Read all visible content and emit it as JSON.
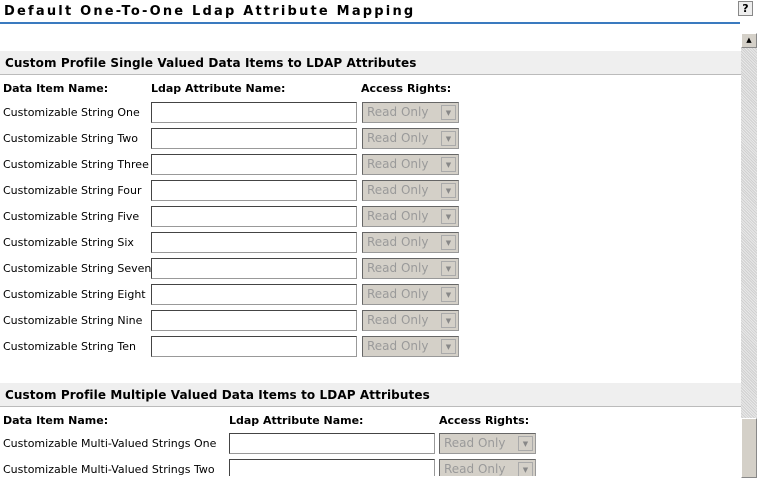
{
  "title": "Default One-To-One Ldap Attribute Mapping",
  "help_label": "?",
  "single": {
    "heading": "Custom Profile Single Valued Data Items to LDAP Attributes",
    "col_item": "Data Item Name:",
    "col_attr": "Ldap Attribute Name:",
    "col_rights": "Access Rights:",
    "rows": [
      {
        "label": "Customizable String One",
        "value": "",
        "rights": "Read Only"
      },
      {
        "label": "Customizable String Two",
        "value": "",
        "rights": "Read Only"
      },
      {
        "label": "Customizable String Three",
        "value": "",
        "rights": "Read Only"
      },
      {
        "label": "Customizable String Four",
        "value": "",
        "rights": "Read Only"
      },
      {
        "label": "Customizable String Five",
        "value": "",
        "rights": "Read Only"
      },
      {
        "label": "Customizable String Six",
        "value": "",
        "rights": "Read Only"
      },
      {
        "label": "Customizable String Seven",
        "value": "",
        "rights": "Read Only"
      },
      {
        "label": "Customizable String Eight",
        "value": "",
        "rights": "Read Only"
      },
      {
        "label": "Customizable String Nine",
        "value": "",
        "rights": "Read Only"
      },
      {
        "label": "Customizable String Ten",
        "value": "",
        "rights": "Read Only"
      }
    ]
  },
  "multi": {
    "heading": "Custom Profile Multiple Valued Data Items to LDAP Attributes",
    "col_item": "Data Item Name:",
    "col_attr": "Ldap Attribute Name:",
    "col_rights": "Access Rights:",
    "rows": [
      {
        "label": "Customizable Multi-Valued Strings One",
        "value": "",
        "rights": "Read Only"
      },
      {
        "label": "Customizable Multi-Valued Strings Two",
        "value": "",
        "rights": "Read Only"
      }
    ]
  }
}
